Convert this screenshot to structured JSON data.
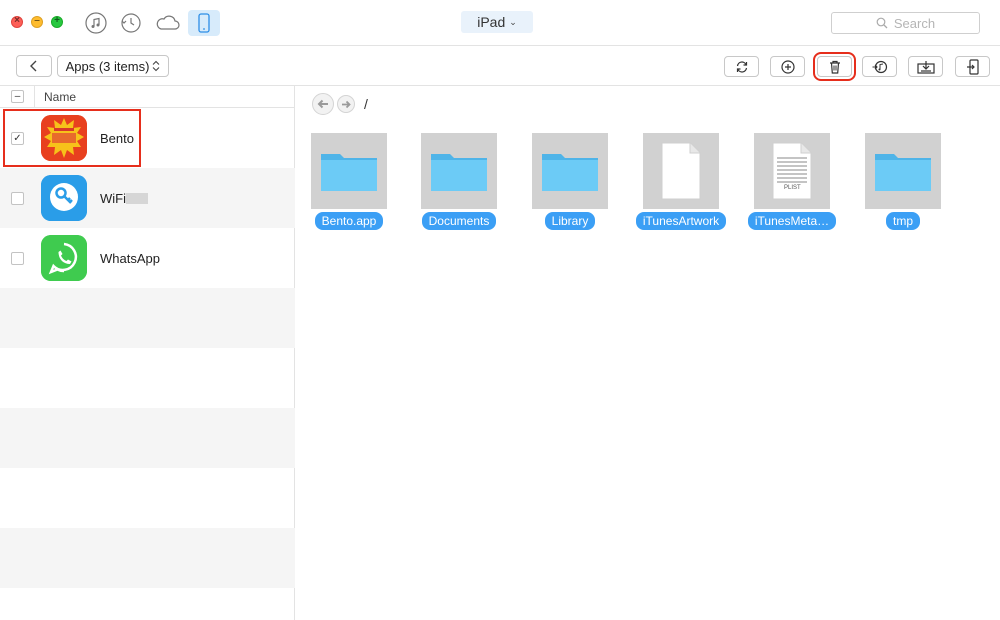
{
  "titlebar": {
    "device_label": "iPad",
    "search_placeholder": "Search",
    "nav": [
      {
        "icon": "music-note-icon"
      },
      {
        "icon": "history-icon"
      },
      {
        "icon": "cloud-icon"
      },
      {
        "icon": "phone-device-icon",
        "active": true
      }
    ]
  },
  "toolbar": {
    "apps_select_label": "Apps (3 items)",
    "buttons": [
      {
        "icon": "refresh-icon"
      },
      {
        "icon": "add-icon"
      },
      {
        "icon": "trash-icon",
        "highlighted": true
      },
      {
        "icon": "to-itunes-icon"
      },
      {
        "icon": "export-to-computer-icon"
      },
      {
        "icon": "import-to-device-icon"
      }
    ]
  },
  "app_list": {
    "column_header": "Name",
    "apps": [
      {
        "name": "Bento",
        "checked": true,
        "icon": "bento-app-icon"
      },
      {
        "name": "WiFi",
        "checked": false,
        "icon": "wifi-key-app-icon"
      },
      {
        "name": "WhatsApp",
        "checked": false,
        "icon": "whatsapp-app-icon"
      }
    ]
  },
  "file_browser": {
    "path": "/",
    "items": [
      {
        "label": "Bento.app",
        "kind": "folder"
      },
      {
        "label": "Documents",
        "kind": "folder"
      },
      {
        "label": "Library",
        "kind": "folder"
      },
      {
        "label": "iTunesArtwork",
        "kind": "file"
      },
      {
        "label": "iTunesMeta…",
        "kind": "plist"
      },
      {
        "label": "tmp",
        "kind": "folder"
      }
    ],
    "plist_badge": "PLIST"
  },
  "colors": {
    "accent_blue": "#3b9ff5",
    "highlight_red": "#e62e1c",
    "folder_blue": "#5ec4f5"
  }
}
